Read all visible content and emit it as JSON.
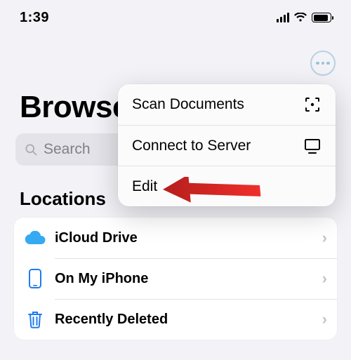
{
  "statusbar": {
    "time": "1:39"
  },
  "header": {
    "title": "Browse",
    "more_button": "more"
  },
  "search": {
    "placeholder": "Search"
  },
  "section": {
    "label": "Locations"
  },
  "locations": [
    {
      "label": "iCloud Drive"
    },
    {
      "label": "On My iPhone"
    },
    {
      "label": "Recently Deleted"
    }
  ],
  "menu": {
    "items": [
      {
        "label": "Scan Documents",
        "icon": "scan-icon"
      },
      {
        "label": "Connect to Server",
        "icon": "display-icon"
      },
      {
        "label": "Edit",
        "icon": ""
      }
    ]
  }
}
